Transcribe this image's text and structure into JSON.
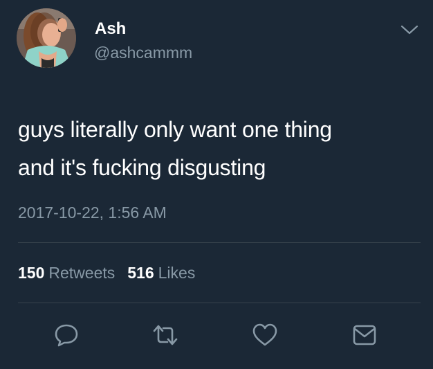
{
  "tweet": {
    "author_name": "Ash",
    "author_handle": "@ashcammm",
    "text_line1": "guys literally only want one thing",
    "text_line2": "and it's fucking disgusting",
    "timestamp": "2017-10-22, 1:56 AM",
    "retweets_count": "150",
    "retweets_label": "Retweets",
    "likes_count": "516",
    "likes_label": "Likes"
  },
  "actions": [
    "reply-icon",
    "retweet-icon",
    "like-icon",
    "direct-message-icon"
  ],
  "colors": {
    "background": "#1b2836",
    "text_primary": "#ffffff",
    "text_secondary": "#8899a6",
    "divider": "#38444d"
  }
}
